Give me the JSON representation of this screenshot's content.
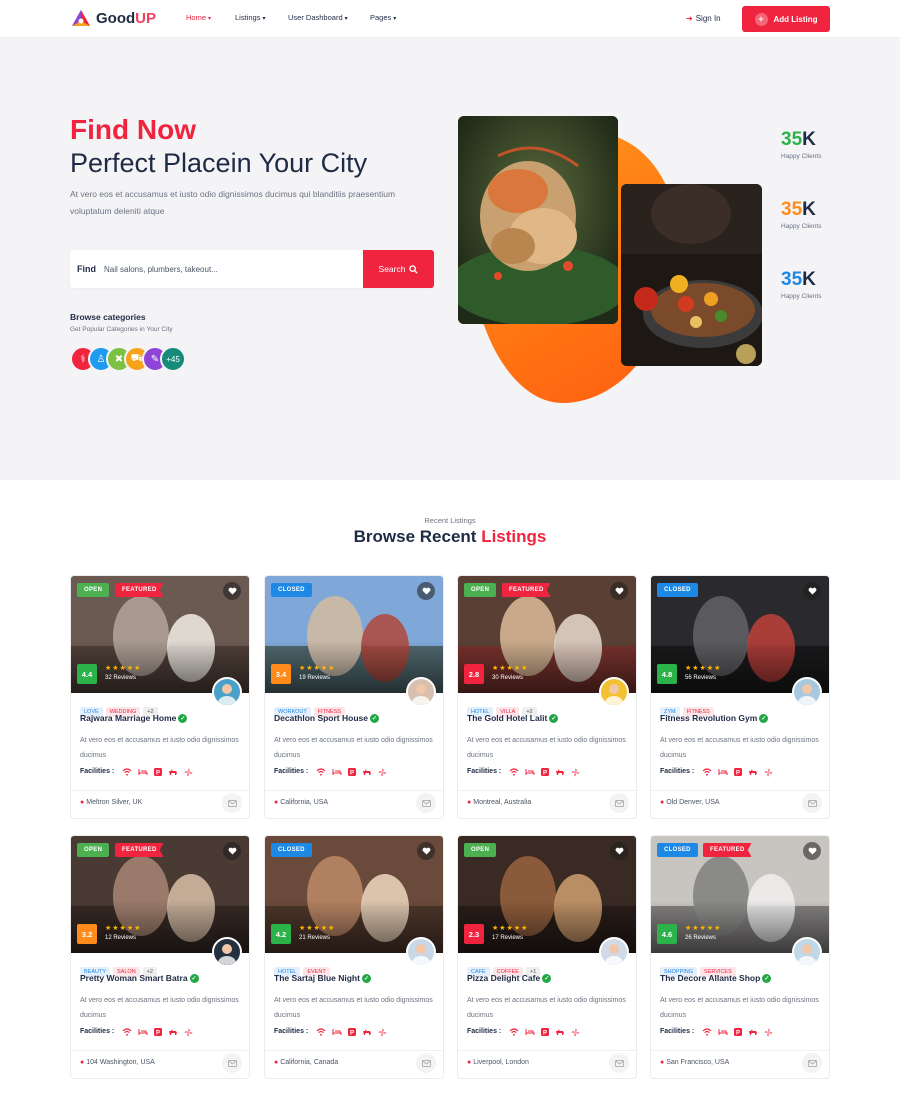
{
  "header": {
    "logo_prefix": "Good",
    "logo_suffix": "UP",
    "nav": [
      {
        "label": "Home",
        "active": true
      },
      {
        "label": "Listings",
        "active": false
      },
      {
        "label": "User Dashboard",
        "active": false
      },
      {
        "label": "Pages",
        "active": false
      }
    ],
    "signin_label": "Sign In",
    "add_listing_label": "Add Listing"
  },
  "hero": {
    "title_accent": "Find Now",
    "title_main": "Perfect Placein Your City",
    "description": "At vero eos et accusamus et iusto odio dignissimos ducimus qui blanditiis praesentium voluptatum deleniti atque",
    "search": {
      "label": "Find",
      "placeholder": "Nail salons, plumbers, takeout...",
      "button_label": "Search"
    },
    "browse_title": "Browse categories",
    "browse_subtitle": "Get Popular Categories in Your City",
    "categories": [
      {
        "icon": "stethoscope-icon",
        "color": "#f0243e"
      },
      {
        "icon": "basket-icon",
        "color": "#1e9af0"
      },
      {
        "icon": "utensils-icon",
        "color": "#7cc142"
      },
      {
        "icon": "car-icon",
        "color": "#f7a21b"
      },
      {
        "icon": "book-icon",
        "color": "#8e44d6"
      }
    ],
    "more_categories": "+45",
    "stats": [
      {
        "value": "35",
        "unit": "K",
        "label": "Happy Clients",
        "color": "#2bb34a"
      },
      {
        "value": "35",
        "unit": "K",
        "label": "Happy Clients",
        "color": "#ff8c1a"
      },
      {
        "value": "35",
        "unit": "K",
        "label": "Happy Clients",
        "color": "#1e88e5"
      }
    ]
  },
  "listings_section": {
    "subtitle": "Recent Listings",
    "title_main": "Browse Recent",
    "title_accent": "Listings",
    "facilities_label": "Facilities :",
    "stars": "★★★★★",
    "cards": [
      {
        "status": "OPEN",
        "featured": "FEATURED",
        "rating": "4.4",
        "rating_color": "#2bb34a",
        "reviews": "32 Reviews",
        "tags": [
          "LOVE",
          "WEDDING",
          "+2"
        ],
        "title": "Rajwara Marriage Home",
        "description": "At vero eos et accusamus et iusto odio dignissimos ducimus",
        "location": "Meltron Silver, UK"
      },
      {
        "status": "CLOSED",
        "featured": "",
        "rating": "3.4",
        "rating_color": "#ff8c1a",
        "reviews": "19 Reviews",
        "tags": [
          "WORKOUT",
          "FITNESS"
        ],
        "title": "Decathlon Sport House",
        "description": "At vero eos et accusamus et iusto odio dignissimos ducimus",
        "location": "California, USA"
      },
      {
        "status": "OPEN",
        "featured": "FEATURED",
        "rating": "2.8",
        "rating_color": "#f0243e",
        "reviews": "30 Reviews",
        "tags": [
          "HOTEL",
          "VILLA",
          "+2"
        ],
        "title": "The Gold Hotel Lalit",
        "description": "At vero eos et accusamus et iusto odio dignissimos ducimus",
        "location": "Montreal, Australia"
      },
      {
        "status": "CLOSED",
        "featured": "",
        "rating": "4.8",
        "rating_color": "#2bb34a",
        "reviews": "56 Reviews",
        "tags": [
          "ZYM",
          "FITNESS"
        ],
        "title": "Fitness Revolution Gym",
        "description": "At vero eos et accusamus et iusto odio dignissimos ducimus",
        "location": "Old Denver, USA"
      },
      {
        "status": "OPEN",
        "featured": "FEATURED",
        "rating": "3.2",
        "rating_color": "#ff8c1a",
        "reviews": "12 Reviews",
        "tags": [
          "BEAUTY",
          "SALON",
          "+2"
        ],
        "title": "Pretty Woman Smart Batra",
        "description": "At vero eos et accusamus et iusto odio dignissimos ducimus",
        "location": "104 Washington, USA"
      },
      {
        "status": "CLOSED",
        "featured": "",
        "rating": "4.2",
        "rating_color": "#2bb34a",
        "reviews": "21 Reviews",
        "tags": [
          "HOTEL",
          "EVENT"
        ],
        "title": "The Sartaj Blue Night",
        "description": "At vero eos et accusamus et iusto odio dignissimos ducimus",
        "location": "California, Canada"
      },
      {
        "status": "OPEN",
        "featured": "",
        "rating": "2.3",
        "rating_color": "#f0243e",
        "reviews": "17 Reviews",
        "tags": [
          "CAFE",
          "COFFEE",
          "+1"
        ],
        "title": "Pizza Delight Cafe",
        "description": "At vero eos et accusamus et iusto odio dignissimos ducimus",
        "location": "Liverpool, London"
      },
      {
        "status": "CLOSED",
        "featured": "FEATURED",
        "rating": "4.6",
        "rating_color": "#2bb34a",
        "reviews": "26 Reviews",
        "tags": [
          "SHOPPING",
          "SERVICES"
        ],
        "title": "The Decore Allante Shop",
        "description": "At vero eos et accusamus et iusto odio dignissimos ducimus",
        "location": "San Francisco, USA"
      }
    ]
  }
}
